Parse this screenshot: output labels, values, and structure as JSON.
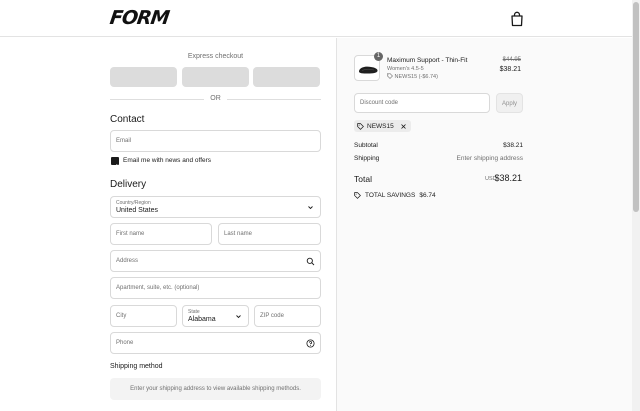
{
  "header": {
    "logo": "FORM",
    "bag_icon": "shopping-bag-icon"
  },
  "express": {
    "title": "Express checkout",
    "or_label": "OR"
  },
  "contact": {
    "title": "Contact",
    "email_placeholder": "Email",
    "newsletter_label": "Email me with news and offers",
    "newsletter_checked": true
  },
  "delivery": {
    "title": "Delivery",
    "country_label": "Country/Region",
    "country_value": "United States",
    "first_name_placeholder": "First name",
    "last_name_placeholder": "Last name",
    "address_placeholder": "Address",
    "apartment_placeholder": "Apartment, suite, etc. (optional)",
    "city_placeholder": "City",
    "state_label": "State",
    "state_value": "Alabama",
    "zip_placeholder": "ZIP code",
    "phone_placeholder": "Phone"
  },
  "shipping": {
    "title": "Shipping method",
    "note": "Enter your shipping address to view available shipping methods."
  },
  "order": {
    "item": {
      "quantity": "1",
      "name": "Maximum Support - Thin-Fit",
      "variant": "Women's 4.5-5",
      "discount": "NEWS15 (-$6.74)",
      "original_price": "$44.95",
      "price": "$38.21"
    },
    "discount_placeholder": "Discount code",
    "apply_label": "Apply",
    "applied_code": "NEWS15",
    "subtotal_label": "Subtotal",
    "subtotal_value": "$38.21",
    "shipping_label": "Shipping",
    "shipping_value": "Enter shipping address",
    "total_label": "Total",
    "currency": "USD",
    "total_value": "$38.21",
    "savings_label": "TOTAL SAVINGS",
    "savings_value": "$6.74"
  },
  "colors": {
    "accent": "#1a1a1a",
    "muted": "#707070",
    "border": "#d9d9d9",
    "panel": "#fafafa"
  }
}
